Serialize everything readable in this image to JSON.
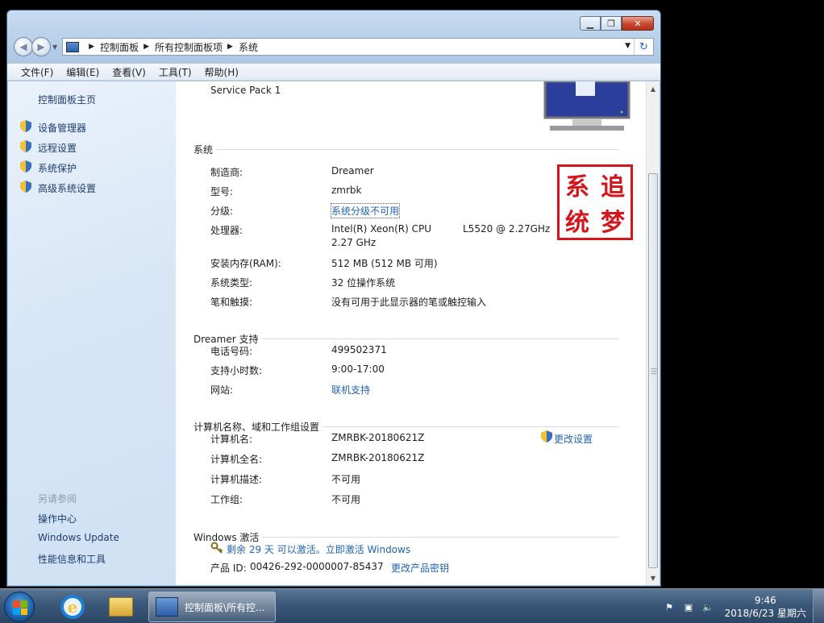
{
  "window": {
    "breadcrumb": [
      "控制面板",
      "所有控制面板项",
      "系统"
    ],
    "menu": [
      "文件(F)",
      "编辑(E)",
      "查看(V)",
      "工具(T)",
      "帮助(H)"
    ]
  },
  "sidebar": {
    "home": "控制面板主页",
    "tasks": [
      "设备管理器",
      "远程设置",
      "系统保护",
      "高级系统设置"
    ],
    "see_also_title": "另请参阅",
    "see_also": [
      "操作中心",
      "Windows Update",
      "性能信息和工具"
    ]
  },
  "content": {
    "service_pack": "Service Pack 1",
    "system": {
      "title": "系统",
      "manufacturer_label": "制造商:",
      "manufacturer": "Dreamer",
      "model_label": "型号:",
      "model": "zmrbk",
      "rating_label": "分级:",
      "rating": "系统分级不可用",
      "cpu_label": "处理器:",
      "cpu_line1": "Intel(R) Xeon(R) CPU",
      "cpu_model": "L5520  @ 2.27GHz",
      "cpu_line2": "2.27 GHz",
      "ram_label": "安装内存(RAM):",
      "ram": "512 MB (512 MB 可用)",
      "type_label": "系统类型:",
      "type": "32 位操作系统",
      "pen_label": "笔和触摸:",
      "pen": "没有可用于此显示器的笔或触控输入"
    },
    "support": {
      "title": "Dreamer 支持",
      "phone_label": "电话号码:",
      "phone": "499502371",
      "hours_label": "支持小时数:",
      "hours": "9:00-17:00",
      "site_label": "网站:",
      "site": "联机支持"
    },
    "computer": {
      "title": "计算机名称、域和工作组设置",
      "name_label": "计算机名:",
      "name": "ZMRBK-20180621Z",
      "full_label": "计算机全名:",
      "full": "ZMRBK-20180621Z",
      "desc_label": "计算机描述:",
      "desc": "不可用",
      "group_label": "工作组:",
      "group": "不可用",
      "change": "更改设置"
    },
    "activation": {
      "title": "Windows 激活",
      "status": "剩余 29 天 可以激活。立即激活 Windows",
      "pid_label": "产品 ID:",
      "pid": "00426-292-0000007-85437",
      "change_key": "更改产品密钥"
    },
    "seal_chars": [
      "系",
      "追",
      "统",
      "梦"
    ]
  },
  "taskbar": {
    "task_label": "控制面板\\所有控...",
    "time": "9:46",
    "date": "2018/6/23 星期六"
  },
  "colors": {
    "link": "#1f64b3",
    "seal": "#d4151b",
    "sidebar": "#d7e6f6"
  }
}
